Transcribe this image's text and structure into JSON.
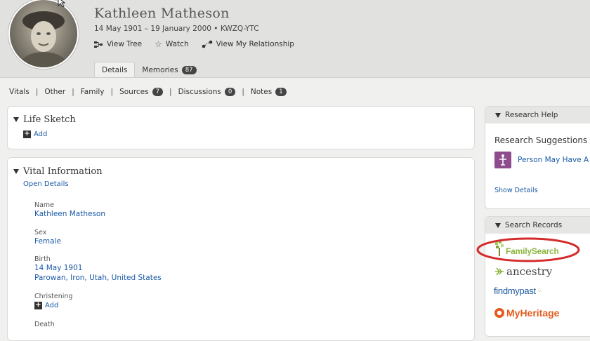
{
  "person": {
    "name": "Kathleen Matheson",
    "lifespan": "14 May 1901 – 19 January 2000 • KWZQ-YTC",
    "actions": {
      "view_tree": "View Tree",
      "watch": "Watch",
      "view_relationship": "View My Relationship"
    }
  },
  "tabs": [
    {
      "label": "Details"
    },
    {
      "label": "Memories",
      "count": "87"
    }
  ],
  "subnav": {
    "vitals": "Vitals",
    "other": "Other",
    "family": "Family",
    "sources": "Sources",
    "sources_count": "7",
    "discussions": "Discussions",
    "discussions_count": "0",
    "notes": "Notes",
    "notes_count": "1"
  },
  "life_sketch": {
    "title": "Life Sketch",
    "add": "Add"
  },
  "vital_info": {
    "title": "Vital Information",
    "open_details": "Open Details",
    "name_label": "Name",
    "name_value": "Kathleen Matheson",
    "sex_label": "Sex",
    "sex_value": "Female",
    "birth_label": "Birth",
    "birth_date": "14 May 1901",
    "birth_place": "Parowan, Iron, Utah, United States",
    "christening_label": "Christening",
    "christening_add": "Add",
    "death_label": "Death"
  },
  "research_help": {
    "title": "Research Help",
    "suggestions": "Research Suggestions",
    "item": "Person May Have A",
    "show_details": "Show Details"
  },
  "search_records": {
    "title": "Search Records",
    "familysearch": "FamilySearch",
    "ancestry": "ancestry",
    "findmypast": "findmypast",
    "myheritage": "MyHeritage"
  },
  "colors": {
    "link": "#1a5aa6",
    "familysearch_green": "#8cb63c",
    "highlight_red": "#d42a2a",
    "myheritage_orange": "#e35b1e",
    "research_purple": "#8e4b8e"
  }
}
